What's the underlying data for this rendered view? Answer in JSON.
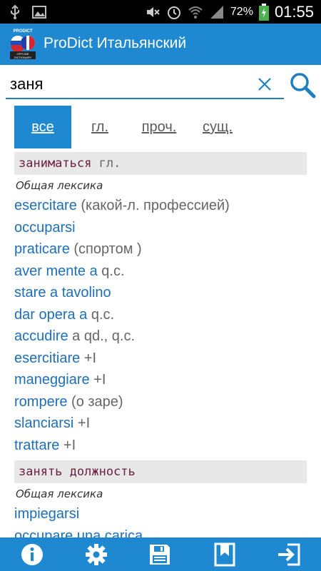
{
  "status_bar": {
    "icons_left": [
      "usb-icon",
      "image-icon"
    ],
    "icons_right": [
      "mute-icon",
      "alarm-icon",
      "wifi-icon",
      "signal-icon",
      "battery-icon"
    ],
    "battery": "72%",
    "time": "01:55"
  },
  "app": {
    "logo_top": "PRODICT",
    "logo_bottom": "OFFLINE DICTIONARY",
    "title": "ProDict Итальянский"
  },
  "search": {
    "query": "заня"
  },
  "tabs": [
    {
      "label": "все",
      "active": true
    },
    {
      "label": "гл.",
      "active": false
    },
    {
      "label": "проч.",
      "active": false
    },
    {
      "label": "сущ.",
      "active": false
    }
  ],
  "results": [
    {
      "headword": "заниматься",
      "pos": " гл.",
      "category": "Общая лексика",
      "translations": [
        {
          "word": "esercitare",
          "note": " (какой-л. профессией)"
        },
        {
          "word": "occuparsi",
          "note": ""
        },
        {
          "word": "praticare",
          "note": " (спортом )"
        },
        {
          "word": "aver mente a",
          "note": " q.c."
        },
        {
          "word": "stare a tavolino",
          "note": ""
        },
        {
          "word": "dar opera a",
          "note": " q.c."
        },
        {
          "word": "accudire",
          "note": " a qd., q.c."
        },
        {
          "word": "esercitiare",
          "note": " +I"
        },
        {
          "word": "maneggiare",
          "note": " +I"
        },
        {
          "word": "rompere",
          "note": " (о заре)"
        },
        {
          "word": "slanciarsi",
          "note": " +I"
        },
        {
          "word": "trattare",
          "note": " +I"
        }
      ]
    },
    {
      "headword": "занять должность",
      "pos": "",
      "category": "Общая лексика",
      "translations": [
        {
          "word": "impiegarsi",
          "note": ""
        },
        {
          "word": "occupare una carica",
          "note": ""
        }
      ]
    }
  ],
  "bottom_bar": [
    "info-icon",
    "settings-icon",
    "save-icon",
    "bookmark-icon",
    "exit-icon"
  ],
  "colors": {
    "primary": "#1e88d1",
    "link": "#1e6fb8",
    "headword": "#6a1f3f",
    "header_bg": "#e8e8e8"
  }
}
